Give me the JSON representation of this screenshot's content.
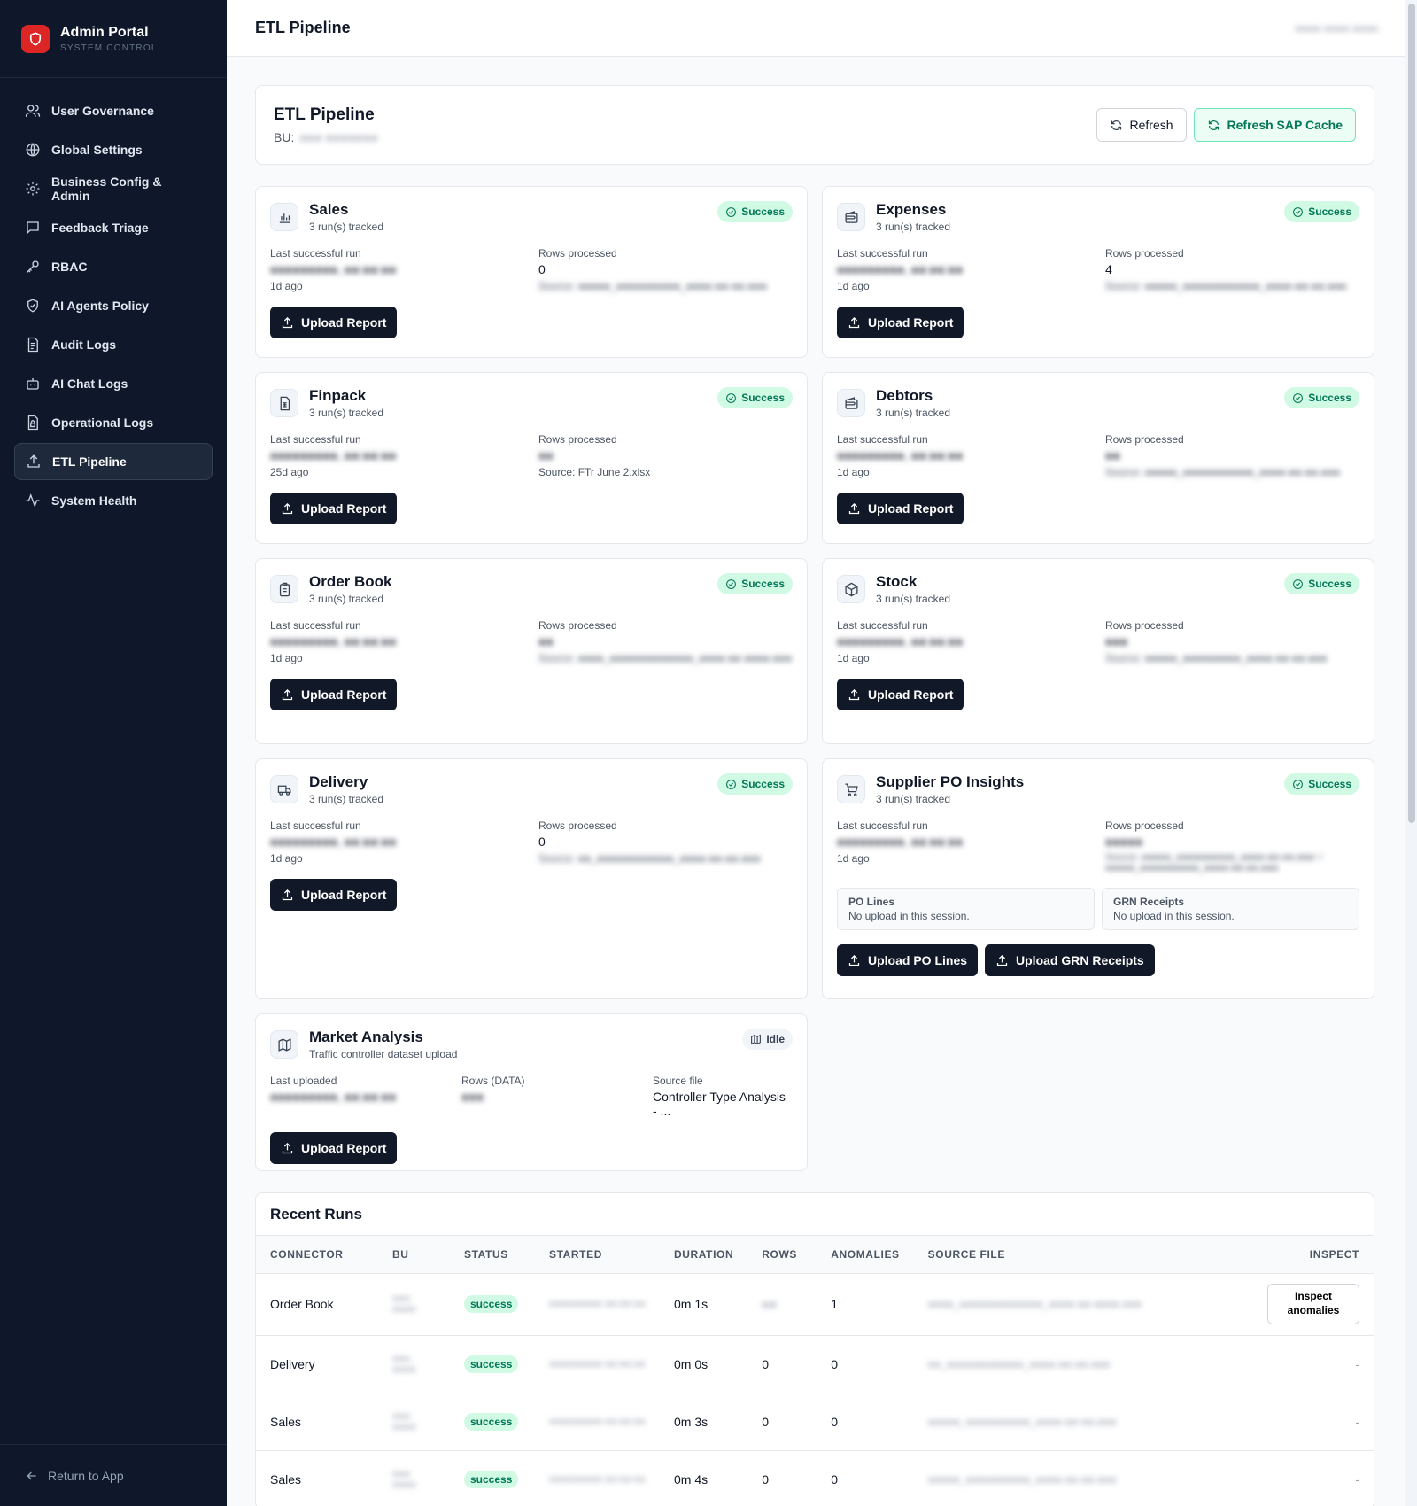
{
  "brand": {
    "title": "Admin Portal",
    "subtitle": "SYSTEM CONTROL",
    "color": "#dc2626"
  },
  "nav": [
    {
      "label": "User Governance",
      "icon": "users-icon"
    },
    {
      "label": "Global Settings",
      "icon": "globe-icon"
    },
    {
      "label": "Business Config & Admin",
      "icon": "gear-icon"
    },
    {
      "label": "Feedback Triage",
      "icon": "message-square-icon"
    },
    {
      "label": "RBAC",
      "icon": "key-icon"
    },
    {
      "label": "AI Agents Policy",
      "icon": "shield-icon"
    },
    {
      "label": "Audit Logs",
      "icon": "file-text-icon"
    },
    {
      "label": "AI Chat Logs",
      "icon": "bot-icon"
    },
    {
      "label": "Operational Logs",
      "icon": "file-lock-icon"
    },
    {
      "label": "ETL Pipeline",
      "icon": "upload-icon",
      "active": true
    },
    {
      "label": "System Health",
      "icon": "activity-icon"
    }
  ],
  "footer": {
    "return_label": "Return to App"
  },
  "topbar": {
    "title": "ETL Pipeline",
    "right_text": "●●●● ●●●● ●●●●"
  },
  "header": {
    "title": "ETL Pipeline",
    "bu_label": "BU:",
    "bu_value": "●●● ●●●●●●●",
    "refresh_label": "Refresh",
    "refresh_sap_label": "Refresh SAP Cache"
  },
  "labels": {
    "last_run": "Last successful run",
    "rows_processed": "Rows processed",
    "upload": "Upload Report",
    "success": "Success"
  },
  "cards": {
    "sales": {
      "title": "Sales",
      "sub": "3 run(s) tracked",
      "last": "●●●●●●●●●, ●●:●●:●●",
      "ago": "1d ago",
      "rows": "0",
      "source": "Source: ●●●●●_●●●●●●●●●●_●●●●-●●-●●.●●●"
    },
    "expenses": {
      "title": "Expenses",
      "sub": "3 run(s) tracked",
      "last": "●●●●●●●●●, ●●:●●:●●",
      "ago": "1d ago",
      "rows": "4",
      "source": "Source: ●●●●●_●●●●●●●●●●●●_●●●●-●●-●●.●●●"
    },
    "finpack": {
      "title": "Finpack",
      "sub": "3 run(s) tracked",
      "last": "●●●●●●●●●, ●●:●●:●●",
      "ago": "25d ago",
      "rows": "●●",
      "source": "Source: FTr June 2.xlsx"
    },
    "debtors": {
      "title": "Debtors",
      "sub": "3 run(s) tracked",
      "last": "●●●●●●●●●, ●●:●●:●●",
      "ago": "1d ago",
      "rows": "●●",
      "source": "Source: ●●●●●_●●●●●●●●●●●_●●●●-●●-●●.●●●"
    },
    "orderbook": {
      "title": "Order Book",
      "sub": "3 run(s) tracked",
      "last": "●●●●●●●●●, ●●:●●:●●",
      "ago": "1d ago",
      "rows": "●●",
      "source": "Source: ●●●●_●●●●●●●●●●●●●_●●●●-●● ●●●●.●●●"
    },
    "stock": {
      "title": "Stock",
      "sub": "3 run(s) tracked",
      "last": "●●●●●●●●●, ●●:●●:●●",
      "ago": "1d ago",
      "rows": "●●●",
      "source": "Source: ●●●●●_●●●●●●●●●_●●●●-●●-●●.●●●"
    },
    "delivery": {
      "title": "Delivery",
      "sub": "3 run(s) tracked",
      "last": "●●●●●●●●●, ●●:●●:●●",
      "ago": "1d ago",
      "rows": "0",
      "source": "Source: ●●_●●●●●●●●●●●●_●●●●-●●-●●.●●●"
    },
    "supplier": {
      "title": "Supplier PO Insights",
      "sub": "3 run(s) tracked",
      "last": "●●●●●●●●●, ●●:●●:●●",
      "ago": "1d ago",
      "rows": "●●●●●",
      "source": "Source: ●●●●●_●●●●●●●●●●_●●●●-●●-●●.●●● + ●●●●●_●●●●●●●●●●_●●●●-●●-●●.●●●",
      "po_title": "PO Lines",
      "po_text": "No upload in this session.",
      "grn_title": "GRN Receipts",
      "grn_text": "No upload in this session.",
      "upload_po": "Upload PO Lines",
      "upload_grn": "Upload GRN Receipts"
    },
    "market": {
      "title": "Market Analysis",
      "sub": "Traffic controller dataset upload",
      "badge": "Idle",
      "last_label": "Last uploaded",
      "last": "●●●●●●●●●, ●●:●●:●●",
      "rows_label": "Rows (DATA)",
      "rows": "●●●",
      "source_label": "Source file",
      "source": "Controller Type Analysis - ..."
    }
  },
  "runs": {
    "title": "Recent Runs",
    "columns": [
      "CONNECTOR",
      "BU",
      "STATUS",
      "STARTED",
      "DURATION",
      "ROWS",
      "ANOMALIES",
      "SOURCE FILE",
      "INSPECT"
    ],
    "inspect_label": "Inspect anomalies",
    "rows": [
      {
        "connector": "Order Book",
        "bu": "●●● ●●●●",
        "status": "success",
        "started": "●●●●●●●●● ●●:●●:●●",
        "duration": "0m 1s",
        "rows": "●●",
        "anomalies": "1",
        "source": "●●●●_●●●●●●●●●●●●●_●●●●-●● ●●●●.●●●",
        "inspect": "button"
      },
      {
        "connector": "Delivery",
        "bu": "●●● ●●●●",
        "status": "success",
        "started": "●●●●●●●●● ●●:●●:●●",
        "duration": "0m 0s",
        "rows": "0",
        "anomalies": "0",
        "source": "●●_●●●●●●●●●●●●_●●●●-●●-●●.●●●",
        "inspect": "-"
      },
      {
        "connector": "Sales",
        "bu": "●●● ●●●●",
        "status": "success",
        "started": "●●●●●●●●● ●●:●●:●●",
        "duration": "0m 3s",
        "rows": "0",
        "anomalies": "0",
        "source": "●●●●●_●●●●●●●●●●_●●●●-●●-●●.●●●",
        "inspect": "-"
      },
      {
        "connector": "Sales",
        "bu": "●●● ●●●●",
        "status": "success",
        "started": "●●●●●●●●● ●●:●●:●●",
        "duration": "0m 4s",
        "rows": "0",
        "anomalies": "0",
        "source": "●●●●●_●●●●●●●●●●_●●●●-●●-●●.●●●",
        "inspect": "-"
      }
    ]
  }
}
